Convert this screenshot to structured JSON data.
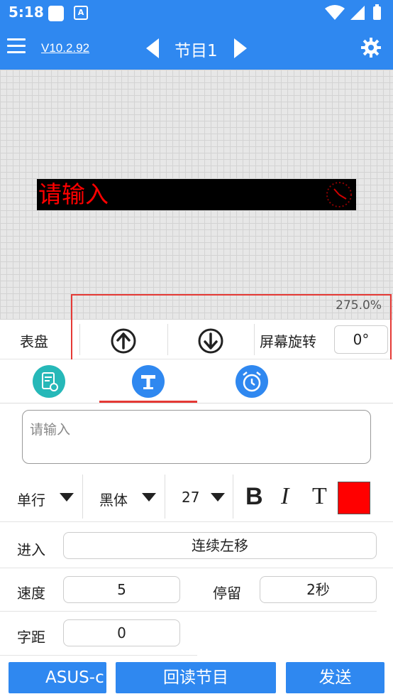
{
  "status_bar": {
    "time": "5:18",
    "a_icon": "A"
  },
  "app_bar": {
    "version": "V10.2.92",
    "program_title": "节目1",
    "icons": [
      "menu-icon",
      "chevron-left-icon",
      "chevron-right-icon",
      "gear-icon"
    ]
  },
  "preview": {
    "screen_text": "请输入",
    "screen_text_color": "#ff0000",
    "zoom": "275.0%"
  },
  "toolbar": {
    "dial_label": "表盘",
    "rotate_label": "屏幕旋转",
    "rotate_value": "0°"
  },
  "tabs": [
    {
      "icon": "document-settings-icon",
      "color": "#26b8b8"
    },
    {
      "icon": "text-icon",
      "color": "#2f88f0",
      "active": true
    },
    {
      "icon": "alarm-clock-icon",
      "color": "#2f88f0"
    }
  ],
  "editor": {
    "text_placeholder": "请输入",
    "line_mode": "单行",
    "font": "黑体",
    "font_size": "27",
    "bold": "B",
    "italic": "I",
    "text_style": "T",
    "text_color": "#ff0000"
  },
  "form": {
    "enter_label": "进入",
    "enter_value": "连续左移",
    "speed_label": "速度",
    "speed_value": "5",
    "stay_label": "停留",
    "stay_value": "2秒",
    "spacing_label": "字距",
    "spacing_value": "0"
  },
  "bottom": {
    "device_label": "ASUS-c",
    "read_back_label": "回读节目",
    "send_label": "发送"
  },
  "colors": {
    "primary": "#2f88f0",
    "accent_red": "#e53935"
  }
}
